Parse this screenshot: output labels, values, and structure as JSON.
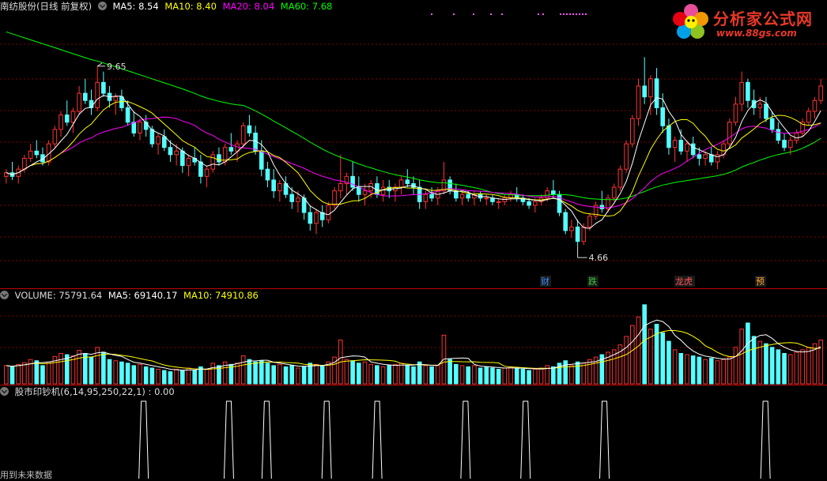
{
  "header": {
    "stock_title": "南纺股份(日线 前复权)",
    "ma5_label": "MA5: 8.54",
    "ma10_label": "MA10: 8.40",
    "ma20_label": "MA20: 8.04",
    "ma60_label": "MA60: 7.68"
  },
  "volume_header": {
    "volume_label": "VOLUME: 75791.64",
    "ma5_label": "MA5: 69140.17",
    "ma10_label": "MA10: 74910.86"
  },
  "indicator_header": {
    "label": "股市印钞机(6,14,95,250,22,1) : 0.00"
  },
  "footer": {
    "text": "用到未来数据"
  },
  "logo": {
    "title": "分析家公式网",
    "url": "www.88gs.com"
  },
  "colors": {
    "up": "#ff3232",
    "down": "#54ffff",
    "ma5": "#ffffff",
    "ma10": "#ffff00",
    "ma20": "#ff00ff",
    "ma60": "#00ff00",
    "grid": "#800000"
  },
  "chart_data": {
    "type": "candlestick",
    "price_high_label": "9.65",
    "price_low_label": "4.66",
    "event_markers": [
      "财",
      "跌",
      "龙虎",
      "预"
    ],
    "candles": [
      [
        6.6,
        6.8,
        6.4,
        6.7
      ],
      [
        6.7,
        7.0,
        6.5,
        6.6
      ],
      [
        6.6,
        6.9,
        6.4,
        6.8
      ],
      [
        6.8,
        7.2,
        6.7,
        7.1
      ],
      [
        7.1,
        7.5,
        7.0,
        7.3
      ],
      [
        7.3,
        7.6,
        7.1,
        7.2
      ],
      [
        7.2,
        7.4,
        6.9,
        7.0
      ],
      [
        7.0,
        7.6,
        6.9,
        7.5
      ],
      [
        7.5,
        8.0,
        7.4,
        7.9
      ],
      [
        7.9,
        8.4,
        7.7,
        8.3
      ],
      [
        8.3,
        8.7,
        8.0,
        8.1
      ],
      [
        8.1,
        8.5,
        7.8,
        8.4
      ],
      [
        8.4,
        9.1,
        8.3,
        8.9
      ],
      [
        8.9,
        9.3,
        8.6,
        8.7
      ],
      [
        8.7,
        9.0,
        8.3,
        8.5
      ],
      [
        8.5,
        9.65,
        8.4,
        9.2
      ],
      [
        9.2,
        9.5,
        8.8,
        8.9
      ],
      [
        8.9,
        9.1,
        8.5,
        8.7
      ],
      [
        8.7,
        8.9,
        8.3,
        8.8
      ],
      [
        8.8,
        9.0,
        8.4,
        8.5
      ],
      [
        8.5,
        8.7,
        8.0,
        8.1
      ],
      [
        8.1,
        8.4,
        7.7,
        7.8
      ],
      [
        7.8,
        8.2,
        7.6,
        8.1
      ],
      [
        8.1,
        8.3,
        7.7,
        7.9
      ],
      [
        7.9,
        8.0,
        7.4,
        7.5
      ],
      [
        7.5,
        7.8,
        7.2,
        7.7
      ],
      [
        7.7,
        7.9,
        7.3,
        7.4
      ],
      [
        7.4,
        7.6,
        7.0,
        7.2
      ],
      [
        7.2,
        7.5,
        6.9,
        7.3
      ],
      [
        7.3,
        7.4,
        6.7,
        6.9
      ],
      [
        6.9,
        7.2,
        6.6,
        7.1
      ],
      [
        7.1,
        7.4,
        6.9,
        7.0
      ],
      [
        7.0,
        7.2,
        6.4,
        6.6
      ],
      [
        6.6,
        6.9,
        6.3,
        6.8
      ],
      [
        6.8,
        7.3,
        6.7,
        7.2
      ],
      [
        7.2,
        7.4,
        6.9,
        7.0
      ],
      [
        7.0,
        7.5,
        6.9,
        7.4
      ],
      [
        7.4,
        7.8,
        7.2,
        7.3
      ],
      [
        7.3,
        7.6,
        7.0,
        7.5
      ],
      [
        7.5,
        8.1,
        7.4,
        8.0
      ],
      [
        8.0,
        8.3,
        7.7,
        7.8
      ],
      [
        7.8,
        8.0,
        7.2,
        7.3
      ],
      [
        7.3,
        7.6,
        6.6,
        6.8
      ],
      [
        6.8,
        7.0,
        6.3,
        6.5
      ],
      [
        6.5,
        6.8,
        6.0,
        6.2
      ],
      [
        6.2,
        6.5,
        5.9,
        6.4
      ],
      [
        6.4,
        6.6,
        6.0,
        6.1
      ],
      [
        6.1,
        6.3,
        5.7,
        5.9
      ],
      [
        5.9,
        6.2,
        5.6,
        6.0
      ],
      [
        6.0,
        6.1,
        5.4,
        5.6
      ],
      [
        5.6,
        5.8,
        5.1,
        5.3
      ],
      [
        5.3,
        5.7,
        5.0,
        5.6
      ],
      [
        5.6,
        5.8,
        5.2,
        5.4
      ],
      [
        5.4,
        5.9,
        5.3,
        5.8
      ],
      [
        5.8,
        6.3,
        5.7,
        6.2
      ],
      [
        6.2,
        7.2,
        6.0,
        6.4
      ],
      [
        6.4,
        6.7,
        6.1,
        6.6
      ],
      [
        6.6,
        7.0,
        6.2,
        6.3
      ],
      [
        6.3,
        6.6,
        5.9,
        6.1
      ],
      [
        6.1,
        6.4,
        5.8,
        6.2
      ],
      [
        6.2,
        6.5,
        6.0,
        6.4
      ],
      [
        6.4,
        6.6,
        6.0,
        6.1
      ],
      [
        6.1,
        6.5,
        5.9,
        6.3
      ],
      [
        6.3,
        6.5,
        6.0,
        6.2
      ],
      [
        6.2,
        6.4,
        5.9,
        6.3
      ],
      [
        6.3,
        6.6,
        6.1,
        6.5
      ],
      [
        6.5,
        6.8,
        6.3,
        6.4
      ],
      [
        6.4,
        6.6,
        6.1,
        6.3
      ],
      [
        6.3,
        6.5,
        5.7,
        5.9
      ],
      [
        5.9,
        6.2,
        5.7,
        6.1
      ],
      [
        6.1,
        6.3,
        5.9,
        6.0
      ],
      [
        6.0,
        6.3,
        5.8,
        6.2
      ],
      [
        6.2,
        7.0,
        6.1,
        6.5
      ],
      [
        6.5,
        6.6,
        6.1,
        6.2
      ],
      [
        6.2,
        6.4,
        5.9,
        6.0
      ],
      [
        6.0,
        6.2,
        5.8,
        6.1
      ],
      [
        6.1,
        6.2,
        5.9,
        6.0
      ],
      [
        6.0,
        6.2,
        5.8,
        6.1
      ],
      [
        6.1,
        6.2,
        5.9,
        6.0
      ],
      [
        6.0,
        6.1,
        5.8,
        6.0
      ],
      [
        6.0,
        6.1,
        5.8,
        5.9
      ],
      [
        5.9,
        6.0,
        5.7,
        5.9
      ],
      [
        5.9,
        6.1,
        5.8,
        6.0
      ],
      [
        6.0,
        6.2,
        5.9,
        6.1
      ],
      [
        6.1,
        6.3,
        5.9,
        6.0
      ],
      [
        6.0,
        6.1,
        5.8,
        5.9
      ],
      [
        5.9,
        6.0,
        5.7,
        5.8
      ],
      [
        5.8,
        6.0,
        5.6,
        5.9
      ],
      [
        5.9,
        6.1,
        5.8,
        6.0
      ],
      [
        6.0,
        6.3,
        5.9,
        6.2
      ],
      [
        6.2,
        6.5,
        6.0,
        6.1
      ],
      [
        6.1,
        6.2,
        5.5,
        5.6
      ],
      [
        5.6,
        5.7,
        5.0,
        5.1
      ],
      [
        5.1,
        5.4,
        4.9,
        5.2
      ],
      [
        5.2,
        5.4,
        4.66,
        4.8
      ],
      [
        4.8,
        5.3,
        4.7,
        5.2
      ],
      [
        5.2,
        5.6,
        5.1,
        5.5
      ],
      [
        5.5,
        5.9,
        5.4,
        5.8
      ],
      [
        5.8,
        6.2,
        5.6,
        5.7
      ],
      [
        5.7,
        6.1,
        5.6,
        6.0
      ],
      [
        6.0,
        6.4,
        5.9,
        6.3
      ],
      [
        6.3,
        6.9,
        6.2,
        6.8
      ],
      [
        6.8,
        7.6,
        6.7,
        7.5
      ],
      [
        7.5,
        8.3,
        7.4,
        8.2
      ],
      [
        8.2,
        9.3,
        8.0,
        9.1
      ],
      [
        9.1,
        9.9,
        8.6,
        8.8
      ],
      [
        8.8,
        9.4,
        8.3,
        9.3
      ],
      [
        9.3,
        9.6,
        8.3,
        8.5
      ],
      [
        8.5,
        8.9,
        7.8,
        8.0
      ],
      [
        8.0,
        8.2,
        7.2,
        7.4
      ],
      [
        7.4,
        7.7,
        7.0,
        7.6
      ],
      [
        7.6,
        7.9,
        7.2,
        7.3
      ],
      [
        7.3,
        7.6,
        7.0,
        7.5
      ],
      [
        7.5,
        7.7,
        7.1,
        7.2
      ],
      [
        7.2,
        7.4,
        6.9,
        7.1
      ],
      [
        7.1,
        7.3,
        6.9,
        7.2
      ],
      [
        7.2,
        7.4,
        6.9,
        7.0
      ],
      [
        7.0,
        7.3,
        6.8,
        7.2
      ],
      [
        7.2,
        7.6,
        7.1,
        7.5
      ],
      [
        7.5,
        8.2,
        7.4,
        8.1
      ],
      [
        8.1,
        8.8,
        8.0,
        8.6
      ],
      [
        8.6,
        9.5,
        8.4,
        9.2
      ],
      [
        9.2,
        9.3,
        8.5,
        8.7
      ],
      [
        8.7,
        9.0,
        8.3,
        8.5
      ],
      [
        8.5,
        8.8,
        8.2,
        8.6
      ],
      [
        8.6,
        8.8,
        8.1,
        8.2
      ],
      [
        8.2,
        8.4,
        7.8,
        7.9
      ],
      [
        7.9,
        8.1,
        7.5,
        7.6
      ],
      [
        7.6,
        7.8,
        7.3,
        7.4
      ],
      [
        7.4,
        7.7,
        7.2,
        7.6
      ],
      [
        7.6,
        7.9,
        7.5,
        7.8
      ],
      [
        7.8,
        8.2,
        7.7,
        8.1
      ],
      [
        8.1,
        8.5,
        8.0,
        8.4
      ],
      [
        8.4,
        8.8,
        8.2,
        8.7
      ],
      [
        8.7,
        9.3,
        8.6,
        9.1
      ]
    ],
    "volume": [
      30,
      28,
      32,
      35,
      40,
      38,
      30,
      36,
      45,
      50,
      48,
      46,
      55,
      50,
      44,
      60,
      52,
      40,
      38,
      36,
      34,
      30,
      32,
      28,
      26,
      24,
      22,
      20,
      24,
      22,
      26,
      22,
      28,
      24,
      34,
      30,
      36,
      32,
      34,
      46,
      40,
      36,
      38,
      34,
      30,
      32,
      28,
      30,
      26,
      28,
      34,
      32,
      30,
      36,
      44,
      72,
      40,
      38,
      34,
      36,
      32,
      30,
      28,
      30,
      32,
      34,
      30,
      28,
      36,
      30,
      28,
      30,
      80,
      40,
      32,
      30,
      28,
      30,
      26,
      28,
      26,
      24,
      26,
      28,
      26,
      24,
      22,
      24,
      26,
      30,
      28,
      34,
      38,
      30,
      36,
      34,
      40,
      44,
      48,
      52,
      56,
      64,
      78,
      96,
      110,
      130,
      90,
      98,
      84,
      70,
      56,
      50,
      48,
      46,
      44,
      40,
      42,
      38,
      40,
      44,
      60,
      90,
      100,
      78,
      70,
      66,
      60,
      56,
      50,
      48,
      52,
      56,
      60,
      66,
      72
    ],
    "volume_up": [
      1,
      0,
      1,
      1,
      1,
      0,
      0,
      1,
      1,
      1,
      0,
      1,
      1,
      0,
      0,
      1,
      0,
      0,
      1,
      0,
      0,
      0,
      1,
      0,
      0,
      1,
      0,
      0,
      1,
      0,
      1,
      0,
      0,
      1,
      1,
      0,
      1,
      0,
      1,
      1,
      0,
      0,
      0,
      0,
      0,
      1,
      0,
      0,
      1,
      0,
      0,
      1,
      0,
      1,
      1,
      1,
      1,
      0,
      0,
      1,
      1,
      0,
      1,
      0,
      1,
      1,
      0,
      0,
      0,
      1,
      0,
      1,
      1,
      0,
      0,
      1,
      0,
      1,
      0,
      0,
      0,
      0,
      1,
      1,
      0,
      0,
      0,
      1,
      1,
      1,
      0,
      0,
      0,
      1,
      0,
      1,
      1,
      1,
      0,
      1,
      1,
      1,
      1,
      1,
      1,
      0,
      1,
      0,
      0,
      0,
      1,
      0,
      1,
      0,
      0,
      1,
      0,
      1,
      1,
      1,
      1,
      1,
      0,
      0,
      1,
      0,
      0,
      0,
      0,
      1,
      1,
      1,
      1,
      1,
      1
    ],
    "indicator_signals": [
      44,
      71,
      83,
      102,
      118,
      146,
      165,
      190,
      241
    ],
    "indicator_total": 260
  }
}
